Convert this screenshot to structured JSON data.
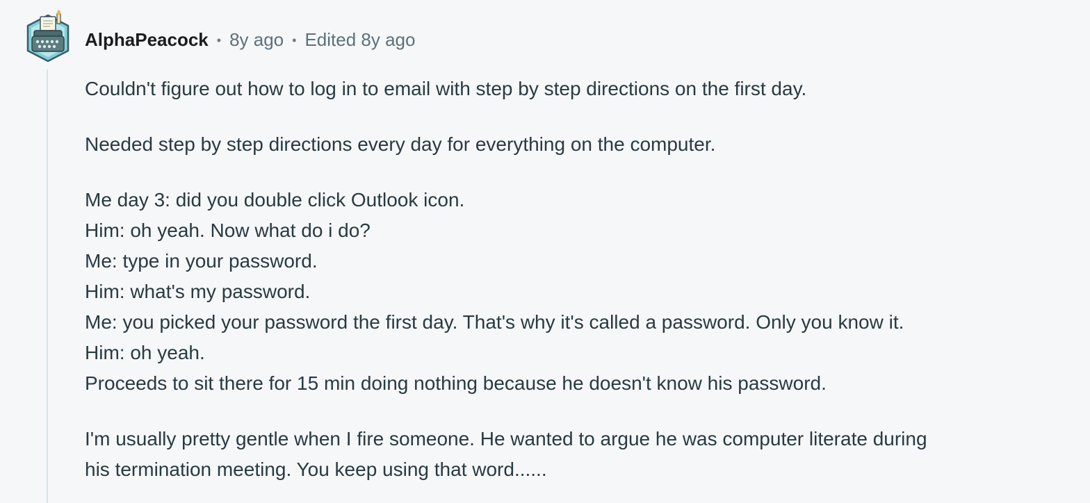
{
  "comment": {
    "author": "AlphaPeacock",
    "separator": "•",
    "timestamp": "8y ago",
    "edited": "Edited 8y ago",
    "avatar_icon": "typewriter-snoo-avatar-icon",
    "colors": {
      "background": "#f6f7f8",
      "thread_line": "#d6e4ed",
      "author": "#1c1c1c",
      "meta": "#5c707c",
      "body": "#283a42"
    },
    "paragraphs": [
      {
        "lines": [
          "Couldn't figure out how to log in to email with step by step directions on the first day."
        ]
      },
      {
        "lines": [
          "Needed step by step directions every day for everything on the computer."
        ]
      },
      {
        "lines": [
          "Me day 3: did you double click Outlook icon.",
          "Him: oh yeah. Now what do i do?",
          "Me: type in your password.",
          "Him: what's my password.",
          "Me: you picked your password the first day. That's why it's called a password. Only you know it.",
          "Him: oh yeah.",
          "Proceeds to sit there for 15 min doing nothing because he doesn't know his password."
        ]
      },
      {
        "lines": [
          "I'm usually pretty gentle when I fire someone. He wanted to argue he was computer literate during",
          "his termination meeting. You keep using that word......"
        ]
      }
    ]
  }
}
